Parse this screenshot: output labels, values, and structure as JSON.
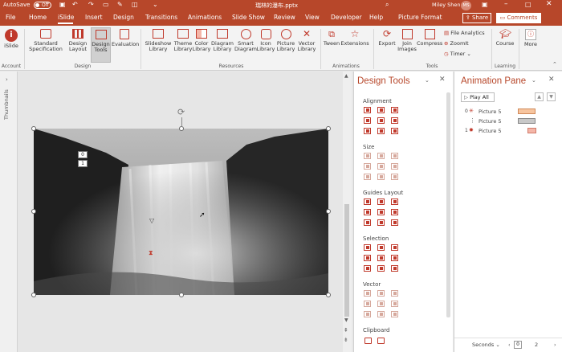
{
  "titlebar": {
    "autosave_label": "AutoSave",
    "autosave_state": "Off",
    "filename": "瑞林的瀑布.pptx",
    "user_name": "Miley Shen",
    "user_initials": "MS"
  },
  "tabs": [
    "File",
    "Home",
    "iSlide",
    "Insert",
    "Design",
    "Transitions",
    "Animations",
    "Slide Show",
    "Review",
    "View",
    "Developer",
    "Help",
    "Picture Format"
  ],
  "tab_actions": {
    "share": "Share",
    "comments": "Comments"
  },
  "ribbon": {
    "account": {
      "label": "iSlide",
      "group": "Account"
    },
    "design": {
      "items": [
        "Standard Specification",
        "Design Layout",
        "Design Tools",
        "Evaluation"
      ],
      "group": "Design"
    },
    "resources": {
      "items": [
        "Slideshow Library",
        "Theme Library",
        "Color Library",
        "Diagram Library",
        "Smart Diagram",
        "Icon Library",
        "Picture Library",
        "Vector Library"
      ],
      "group": "Resources"
    },
    "animations": {
      "items": [
        "Tween",
        "Extensions"
      ],
      "group": "Animations"
    },
    "tools": {
      "items": [
        "Export",
        "Join Images",
        "Compress"
      ],
      "small": [
        "File Analytics",
        "ZoomIt",
        "Timer"
      ],
      "group": "Tools"
    },
    "learning": {
      "items": [
        "Course"
      ],
      "group": "Learning"
    },
    "more": "More"
  },
  "left_strip": {
    "label": "Thumbnails"
  },
  "slide": {
    "tag_top": "0",
    "tag_bottom": "1"
  },
  "design_tools": {
    "title": "Design Tools",
    "sections": [
      "Alignment",
      "Size",
      "Guides Layout",
      "Selection",
      "Vector",
      "Clipboard"
    ]
  },
  "animation_pane": {
    "title": "Animation Pane",
    "play_all": "Play All",
    "rows": [
      {
        "index": "0",
        "name": "Picture 5",
        "bar_color": "#f7c59f"
      },
      {
        "index": "",
        "name": "Picture 5",
        "bar_color": "#c8c8c8"
      },
      {
        "index": "1",
        "name": "Picture 5",
        "bar_color": "#f4b6a8"
      }
    ],
    "seconds_label": "Seconds",
    "timeline_start": "0",
    "timeline_mark": "2"
  },
  "colors": {
    "accent": "#b7472a"
  }
}
